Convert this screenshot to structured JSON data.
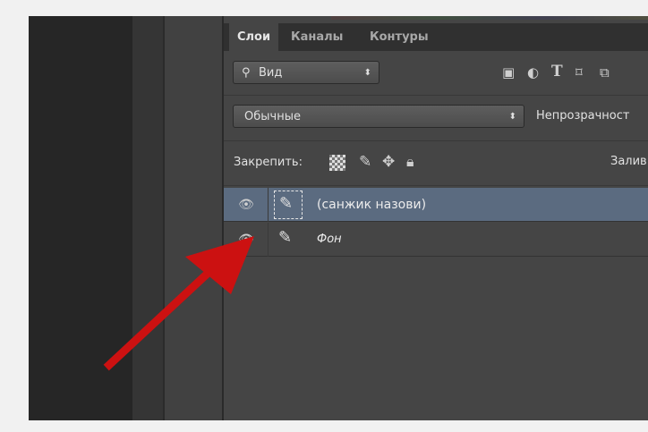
{
  "tabs": [
    {
      "label": "Слои",
      "active": true
    },
    {
      "label": "Каналы",
      "active": false
    },
    {
      "label": "Контуры",
      "active": false
    }
  ],
  "filter": {
    "icon": "search-icon",
    "label": "Вид"
  },
  "filter_icons": [
    "image-filter-icon",
    "adjustment-filter-icon",
    "text-filter-icon",
    "shape-filter-icon",
    "smart-object-filter-icon"
  ],
  "blend": {
    "mode": "Обычные",
    "opacity_label": "Непрозрачност"
  },
  "lock": {
    "label": "Закрепить:",
    "fill_label": "Залив",
    "icons": [
      "lock-transparent-pixels-icon",
      "lock-image-pixels-icon",
      "lock-position-icon",
      "lock-all-icon"
    ]
  },
  "layers": [
    {
      "name": "(санжик назови)",
      "selected": true,
      "visible": true
    },
    {
      "name": "Фон",
      "selected": false,
      "visible": true
    }
  ],
  "annotation": {
    "color": "#cc1111"
  }
}
